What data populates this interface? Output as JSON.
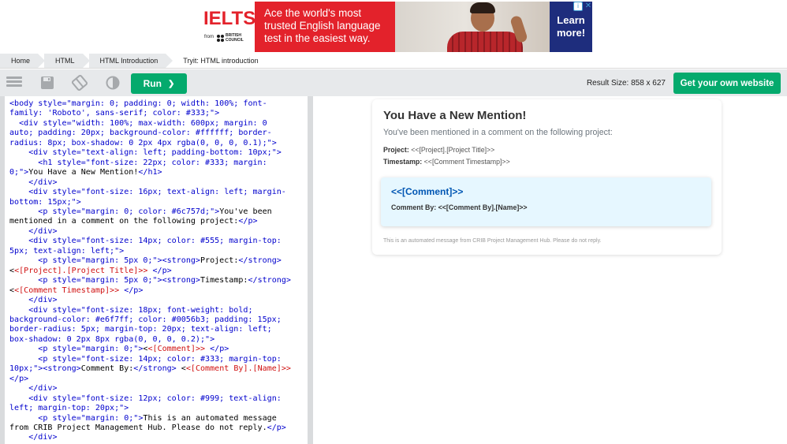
{
  "ad": {
    "brand": "IELTS",
    "from": "from",
    "partner_line1": "BRITISH",
    "partner_line2": "COUNCIL",
    "headline": "Ace the world's most trusted English language test in the easiest way.",
    "cta_line1": "Learn",
    "cta_line2": "more!",
    "adchoice": "i",
    "close": "✕",
    "colors": {
      "brand_red": "#e3222b",
      "cta_blue": "#1e2d7d"
    }
  },
  "breadcrumb": [
    "Home",
    "HTML",
    "HTML Introduction",
    "Tryit: HTML introduction"
  ],
  "toolbar": {
    "menu_icon": "menu-icon",
    "save_icon": "save-icon",
    "rotate_icon": "rotate-icon",
    "theme_icon": "contrast-icon",
    "run_label": "Run",
    "run_chevron": "❯",
    "result_size": "Result Size: 858 x 627",
    "get_website": "Get your own website",
    "colors": {
      "accent_green": "#04aa6d",
      "bar_gray": "#e7e9eb"
    }
  },
  "code_lines": [
    [
      [
        "tag",
        "<body "
      ],
      [
        "attr",
        "style="
      ],
      [
        "val",
        "\"margin: 0; padding: 0; width: 100%; font-"
      ]
    ],
    [
      [
        "val",
        "family: 'Roboto', sans-serif; color: #333;\""
      ],
      [
        "tag",
        ">"
      ]
    ],
    [
      [
        "txt",
        "  "
      ],
      [
        "tag",
        "<div "
      ],
      [
        "attr",
        "style="
      ],
      [
        "val",
        "\"width: 100%; max-width: 600px; margin: 0"
      ]
    ],
    [
      [
        "val",
        "auto; padding: 20px; background-color: #ffffff; border-"
      ]
    ],
    [
      [
        "val",
        "radius: 8px; box-shadow: 0 2px 4px rgba(0, 0, 0, 0.1);\""
      ],
      [
        "tag",
        ">"
      ]
    ],
    [
      [
        "txt",
        "    "
      ],
      [
        "tag",
        "<div "
      ],
      [
        "attr",
        "style="
      ],
      [
        "val",
        "\"text-align: left; padding-bottom: 10px;\""
      ],
      [
        "tag",
        ">"
      ]
    ],
    [
      [
        "txt",
        "      "
      ],
      [
        "tag",
        "<h1 "
      ],
      [
        "attr",
        "style="
      ],
      [
        "val",
        "\"font-size: 22px; color: #333; margin:"
      ]
    ],
    [
      [
        "val",
        "0;\""
      ],
      [
        "tag",
        ">"
      ],
      [
        "txt",
        "You Have a New Mention!"
      ],
      [
        "tag",
        "</h1>"
      ]
    ],
    [
      [
        "txt",
        "    "
      ],
      [
        "tag",
        "</div>"
      ]
    ],
    [
      [
        "txt",
        "    "
      ],
      [
        "tag",
        "<div "
      ],
      [
        "attr",
        "style="
      ],
      [
        "val",
        "\"font-size: 16px; text-align: left; margin-"
      ]
    ],
    [
      [
        "val",
        "bottom: 15px;\""
      ],
      [
        "tag",
        ">"
      ]
    ],
    [
      [
        "txt",
        "      "
      ],
      [
        "tag",
        "<p "
      ],
      [
        "attr",
        "style="
      ],
      [
        "val",
        "\"margin: 0; color: #6c757d;\""
      ],
      [
        "tag",
        ">"
      ],
      [
        "txt",
        "You've been"
      ]
    ],
    [
      [
        "txt",
        "mentioned in a comment on the following project:"
      ],
      [
        "tag",
        "</p>"
      ]
    ],
    [
      [
        "txt",
        "    "
      ],
      [
        "tag",
        "</div>"
      ]
    ],
    [
      [
        "txt",
        "    "
      ],
      [
        "tag",
        "<div "
      ],
      [
        "attr",
        "style="
      ],
      [
        "val",
        "\"font-size: 14px; color: #555; margin-top:"
      ]
    ],
    [
      [
        "val",
        "5px; text-align: left;\""
      ],
      [
        "tag",
        ">"
      ]
    ],
    [
      [
        "txt",
        "      "
      ],
      [
        "tag",
        "<p "
      ],
      [
        "attr",
        "style="
      ],
      [
        "val",
        "\"margin: 5px 0;\""
      ],
      [
        "tag",
        "><strong>"
      ],
      [
        "txt",
        "Project:"
      ],
      [
        "tag",
        "</strong>"
      ]
    ],
    [
      [
        "txt",
        "<"
      ],
      [
        "ph",
        "<[Project].[Project Title]>>"
      ],
      [
        "txt",
        " "
      ],
      [
        "tag",
        "</p>"
      ]
    ],
    [
      [
        "txt",
        "      "
      ],
      [
        "tag",
        "<p "
      ],
      [
        "attr",
        "style="
      ],
      [
        "val",
        "\"margin: 5px 0;\""
      ],
      [
        "tag",
        "><strong>"
      ],
      [
        "txt",
        "Timestamp:"
      ],
      [
        "tag",
        "</strong>"
      ]
    ],
    [
      [
        "txt",
        "<"
      ],
      [
        "ph",
        "<[Comment Timestamp]>>"
      ],
      [
        "txt",
        " "
      ],
      [
        "tag",
        "</p>"
      ]
    ],
    [
      [
        "txt",
        "    "
      ],
      [
        "tag",
        "</div>"
      ]
    ],
    [
      [
        "txt",
        "    "
      ],
      [
        "tag",
        "<div "
      ],
      [
        "attr",
        "style="
      ],
      [
        "val",
        "\"font-size: 18px; font-weight: bold;"
      ]
    ],
    [
      [
        "val",
        "background-color: #e6f7ff; color: #0056b3; padding: 15px;"
      ]
    ],
    [
      [
        "val",
        "border-radius: 5px; margin-top: 20px; text-align: left;"
      ]
    ],
    [
      [
        "val",
        "box-shadow: 0 2px 8px rgba(0, 0, 0, 0.2);\""
      ],
      [
        "tag",
        ">"
      ]
    ],
    [
      [
        "txt",
        "      "
      ],
      [
        "tag",
        "<p "
      ],
      [
        "attr",
        "style="
      ],
      [
        "val",
        "\"margin: 0;\""
      ],
      [
        "tag",
        ">"
      ],
      [
        "txt",
        "<"
      ],
      [
        "ph",
        "<[Comment]>>"
      ],
      [
        "txt",
        " "
      ],
      [
        "tag",
        "</p>"
      ]
    ],
    [
      [
        "txt",
        "      "
      ],
      [
        "tag",
        "<p "
      ],
      [
        "attr",
        "style="
      ],
      [
        "val",
        "\"font-size: 14px; color: #333; margin-top:"
      ]
    ],
    [
      [
        "val",
        "10px;\""
      ],
      [
        "tag",
        "><strong>"
      ],
      [
        "txt",
        "Comment By:"
      ],
      [
        "tag",
        "</strong>"
      ],
      [
        "txt",
        " <"
      ],
      [
        "ph",
        "<[Comment By].[Name]>>"
      ]
    ],
    [
      [
        "tag",
        "</p>"
      ]
    ],
    [
      [
        "txt",
        "    "
      ],
      [
        "tag",
        "</div>"
      ]
    ],
    [
      [
        "txt",
        "    "
      ],
      [
        "tag",
        "<div "
      ],
      [
        "attr",
        "style="
      ],
      [
        "val",
        "\"font-size: 12px; color: #999; text-align:"
      ]
    ],
    [
      [
        "val",
        "left; margin-top: 20px;\""
      ],
      [
        "tag",
        ">"
      ]
    ],
    [
      [
        "txt",
        "      "
      ],
      [
        "tag",
        "<p "
      ],
      [
        "attr",
        "style="
      ],
      [
        "val",
        "\"margin: 0;\""
      ],
      [
        "tag",
        ">"
      ],
      [
        "txt",
        "This is an automated message"
      ]
    ],
    [
      [
        "txt",
        "from CRIB Project Management Hub. Please do not reply."
      ],
      [
        "tag",
        "</p>"
      ]
    ],
    [
      [
        "txt",
        "    "
      ],
      [
        "tag",
        "</div>"
      ]
    ]
  ],
  "result": {
    "title": "You Have a New Mention!",
    "subtitle": "You've been mentioned in a comment on the following project:",
    "project_label": "Project:",
    "project_value": "<<[Project].[Project Title]>>",
    "timestamp_label": "Timestamp:",
    "timestamp_value": "<<[Comment Timestamp]>>",
    "comment": "<<[Comment]>>",
    "comment_by_label": "Comment By:",
    "comment_by_value": "<<[Comment By].[Name]>>",
    "footer": "This is an automated message from CRIB Project Management Hub. Please do not reply."
  }
}
